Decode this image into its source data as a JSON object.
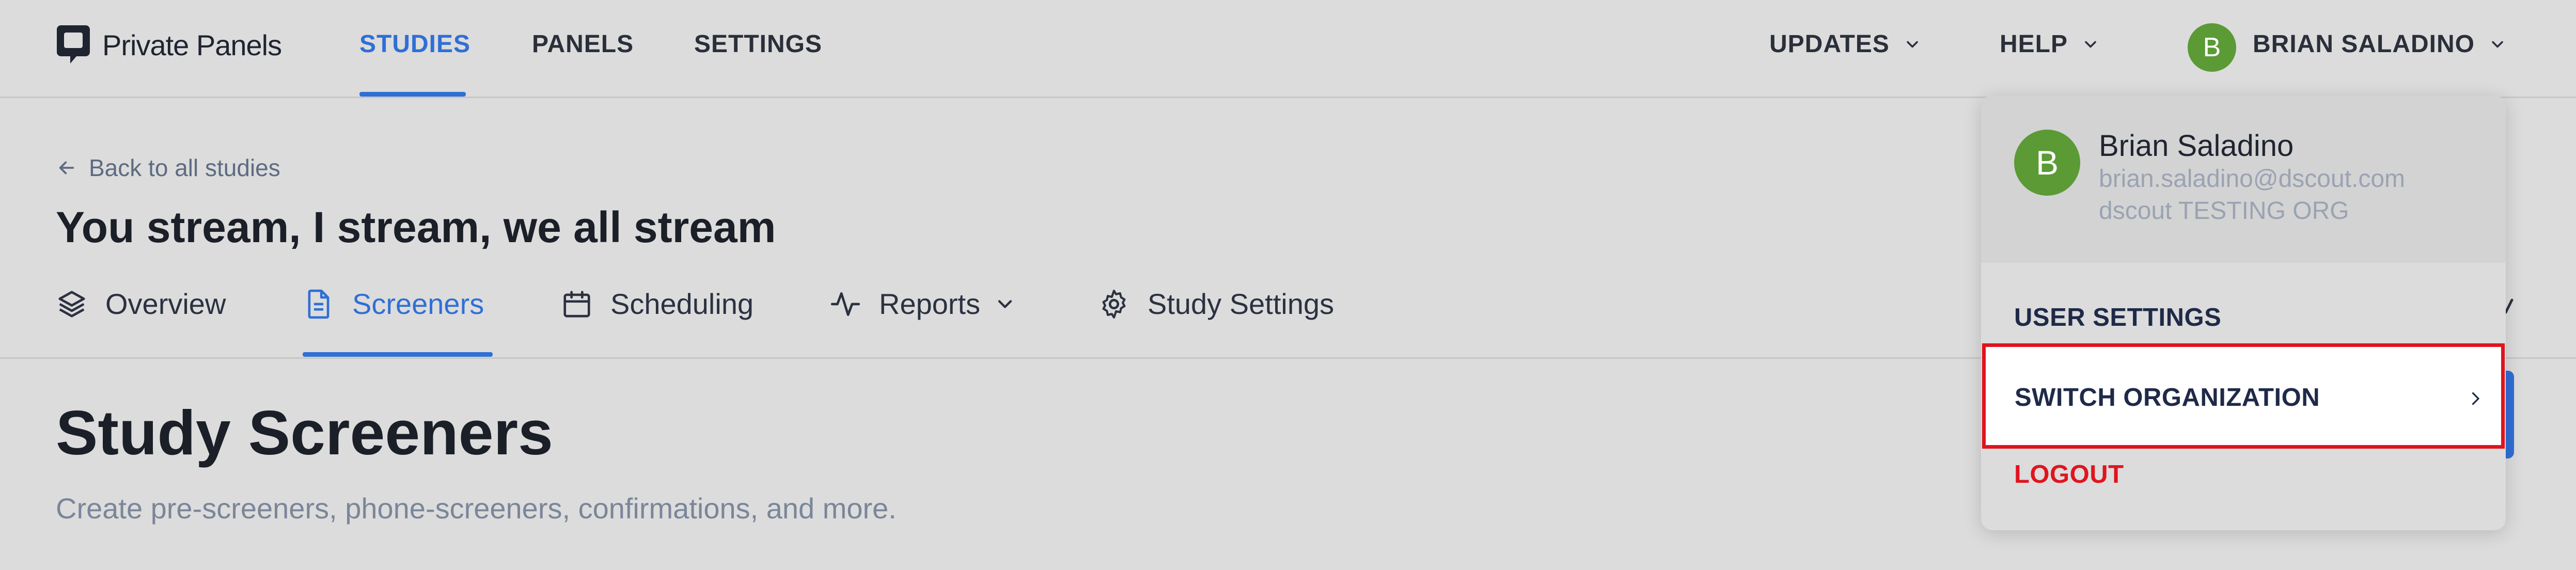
{
  "app": {
    "name": "Private Panels"
  },
  "nav": {
    "items": [
      "STUDIES",
      "PANELS",
      "SETTINGS"
    ],
    "active": "STUDIES"
  },
  "top_menus": {
    "updates": "UPDATES",
    "help": "HELP",
    "user": "BRIAN SALADINO",
    "avatar_initial": "B"
  },
  "breadcrumb": {
    "back_label": "Back to all studies"
  },
  "study": {
    "title": "You stream, I stream, we all stream"
  },
  "tabs": {
    "items": [
      {
        "label": "Overview",
        "icon": "layers-icon"
      },
      {
        "label": "Screeners",
        "icon": "document-icon"
      },
      {
        "label": "Scheduling",
        "icon": "calendar-icon"
      },
      {
        "label": "Reports",
        "icon": "activity-icon"
      },
      {
        "label": "Study Settings",
        "icon": "gear-icon"
      }
    ],
    "active": "Screeners"
  },
  "main": {
    "title": "Study Screeners",
    "subtitle": "Create pre-screeners, phone-screeners, confirmations, and more."
  },
  "user_dropdown": {
    "avatar_initial": "B",
    "name": "Brian Saladino",
    "email": "brian.saladino@dscout.com",
    "org": "dscout TESTING ORG",
    "items": {
      "user_settings": "USER SETTINGS",
      "switch_org": "SWITCH ORGANIZATION",
      "logout": "LOGOUT"
    },
    "highlighted": "SWITCH ORGANIZATION"
  },
  "colors": {
    "accent": "#2f6fd6",
    "avatar": "#5b9a35",
    "danger": "#e0141e",
    "background": "#dcdcdc"
  }
}
